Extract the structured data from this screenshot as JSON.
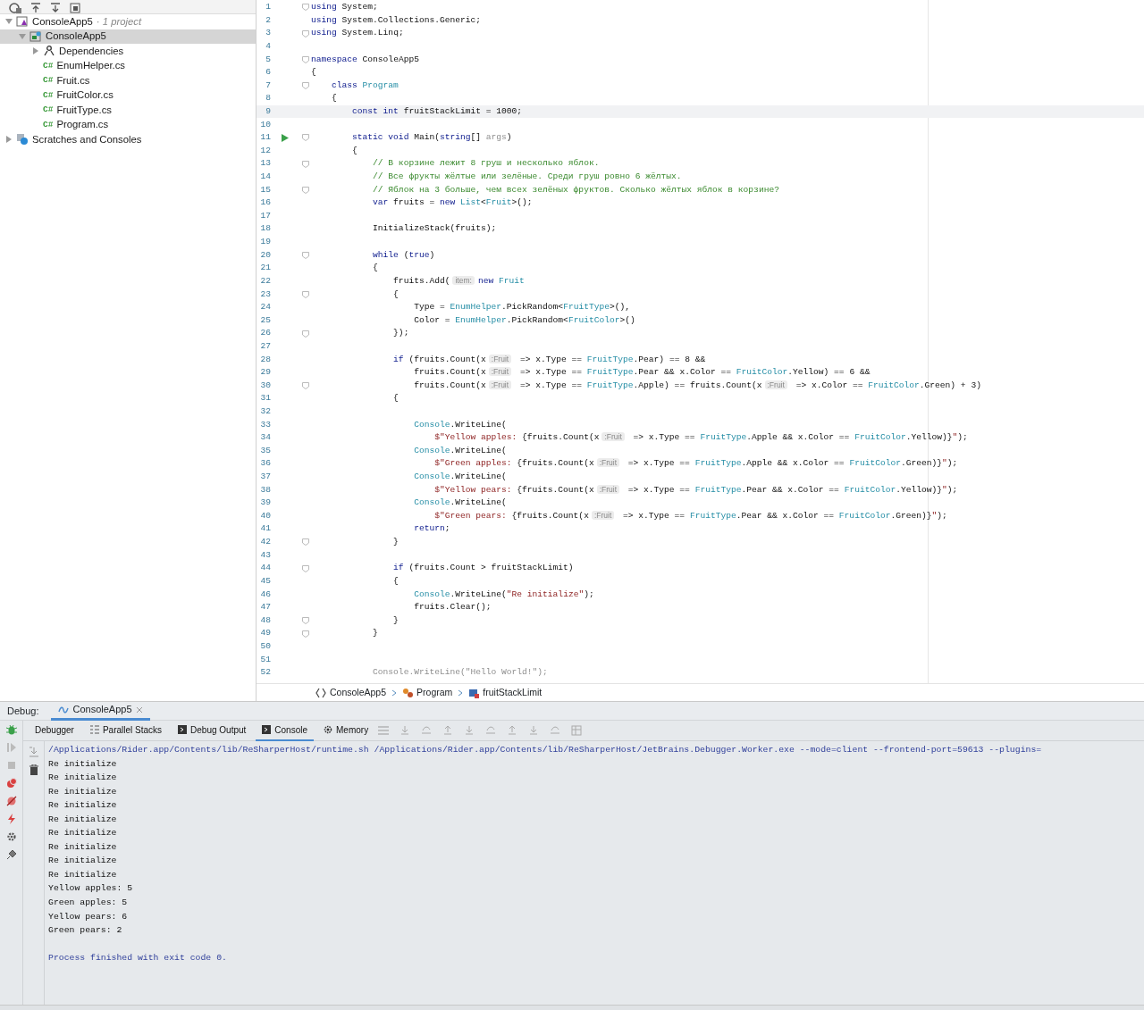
{
  "project_tree": [
    {
      "label": "ConsoleApp5",
      "note": "· 1 project",
      "kind": "solution",
      "expanded": true,
      "selected": false,
      "children": [
        {
          "label": "ConsoleApp5",
          "kind": "project",
          "expanded": true,
          "selected": true,
          "children": [
            {
              "label": "Dependencies",
              "kind": "dependencies",
              "expanded": false,
              "selected": false
            },
            {
              "label": "EnumHelper.cs",
              "badge": "C#",
              "kind": "file",
              "selected": false
            },
            {
              "label": "Fruit.cs",
              "badge": "C#",
              "kind": "file",
              "selected": false
            },
            {
              "label": "FruitColor.cs",
              "badge": "C#",
              "kind": "file",
              "selected": false
            },
            {
              "label": "FruitType.cs",
              "badge": "C#",
              "kind": "file",
              "selected": false
            },
            {
              "label": "Program.cs",
              "badge": "C#",
              "kind": "file",
              "selected": false
            }
          ]
        }
      ]
    },
    {
      "label": "Scratches and Consoles",
      "kind": "scratches",
      "expanded": false,
      "selected": false
    }
  ],
  "editor": {
    "lines": [
      {
        "number": "1",
        "fold": true,
        "tokens": [
          {
            "kind": "kw",
            "text": "using"
          },
          {
            "kind": "plain",
            "text": " System;"
          }
        ]
      },
      {
        "number": "2",
        "tokens": [
          {
            "kind": "kw",
            "text": "using"
          },
          {
            "kind": "plain",
            "text": " System.Collections.Generic;"
          }
        ]
      },
      {
        "number": "3",
        "fold": true,
        "tokens": [
          {
            "kind": "kw",
            "text": "using"
          },
          {
            "kind": "plain",
            "text": " System.Linq;"
          }
        ]
      },
      {
        "number": "4"
      },
      {
        "number": "5",
        "fold": true,
        "tokens": [
          {
            "kind": "kw",
            "text": "namespace"
          },
          {
            "kind": "plain",
            "text": " ConsoleApp5"
          }
        ]
      },
      {
        "number": "6",
        "tokens": [
          {
            "kind": "plain",
            "text": "{"
          }
        ]
      },
      {
        "number": "7",
        "fold": true,
        "tokens": [
          {
            "kind": "kw",
            "text": "    class "
          },
          {
            "kind": "type",
            "text": "Program"
          }
        ]
      },
      {
        "number": "8",
        "tokens": [
          {
            "kind": "plain",
            "text": "    {"
          }
        ]
      },
      {
        "number": "9",
        "highlighted": true,
        "tokens": [
          {
            "kind": "kw",
            "text": "        const int"
          },
          {
            "kind": "plain",
            "text": " fruitStackLimit = 1000;"
          }
        ]
      },
      {
        "number": "10"
      },
      {
        "number": "11",
        "run": true,
        "fold": true,
        "tokens": [
          {
            "kind": "kw",
            "text": "        static void"
          },
          {
            "kind": "plain",
            "text": " Main("
          },
          {
            "kind": "kw",
            "text": "string"
          },
          {
            "kind": "plain",
            "text": "[] "
          },
          {
            "kind": "dim",
            "text": "args"
          },
          {
            "kind": "plain",
            "text": ")"
          }
        ]
      },
      {
        "number": "12",
        "tokens": [
          {
            "kind": "plain",
            "text": "        {"
          }
        ]
      },
      {
        "number": "13",
        "fold": true,
        "tokens": [
          {
            "kind": "comment",
            "text": "            // В корзине лежит 8 груш и несколько яблок."
          }
        ]
      },
      {
        "number": "14",
        "tokens": [
          {
            "kind": "comment",
            "text": "            // Все фрукты жёлтые или зелёные. Среди груш ровно 6 жёлтых."
          }
        ]
      },
      {
        "number": "15",
        "fold": true,
        "tokens": [
          {
            "kind": "comment",
            "text": "            // Яблок на 3 больше, чем всех зелёных фруктов. Сколько жёлтых яблок в корзине?"
          }
        ]
      },
      {
        "number": "16",
        "tokens": [
          {
            "kind": "kw",
            "text": "            var"
          },
          {
            "kind": "plain",
            "text": " fruits = "
          },
          {
            "kind": "kw",
            "text": "new "
          },
          {
            "kind": "type",
            "text": "List"
          },
          {
            "kind": "plain",
            "text": "<"
          },
          {
            "kind": "type",
            "text": "Fruit"
          },
          {
            "kind": "plain",
            "text": ">();"
          }
        ]
      },
      {
        "number": "17"
      },
      {
        "number": "18",
        "tokens": [
          {
            "kind": "plain",
            "text": "            InitializeStack(fruits);"
          }
        ]
      },
      {
        "number": "19"
      },
      {
        "number": "20",
        "fold": true,
        "tokens": [
          {
            "kind": "kw",
            "text": "            while"
          },
          {
            "kind": "plain",
            "text": " ("
          },
          {
            "kind": "kw",
            "text": "true"
          },
          {
            "kind": "plain",
            "text": ")"
          }
        ]
      },
      {
        "number": "21",
        "tokens": [
          {
            "kind": "plain",
            "text": "            {"
          }
        ]
      },
      {
        "number": "22",
        "tokens": [
          {
            "kind": "plain",
            "text": "                fruits.Add("
          },
          {
            "kind": "hint",
            "text": "item:"
          },
          {
            "kind": "kw",
            "text": "new "
          },
          {
            "kind": "type",
            "text": "Fruit"
          }
        ]
      },
      {
        "number": "23",
        "fold": true,
        "tokens": [
          {
            "kind": "plain",
            "text": "                {"
          }
        ]
      },
      {
        "number": "24",
        "tokens": [
          {
            "kind": "plain",
            "text": "                    Type = "
          },
          {
            "kind": "type",
            "text": "EnumHelper"
          },
          {
            "kind": "plain",
            "text": ".PickRandom<"
          },
          {
            "kind": "type",
            "text": "FruitType"
          },
          {
            "kind": "plain",
            "text": ">(),"
          }
        ]
      },
      {
        "number": "25",
        "tokens": [
          {
            "kind": "plain",
            "text": "                    Color = "
          },
          {
            "kind": "type",
            "text": "EnumHelper"
          },
          {
            "kind": "plain",
            "text": ".PickRandom<"
          },
          {
            "kind": "type",
            "text": "FruitColor"
          },
          {
            "kind": "plain",
            "text": ">()"
          }
        ]
      },
      {
        "number": "26",
        "fold": true,
        "tokens": [
          {
            "kind": "plain",
            "text": "                });"
          }
        ]
      },
      {
        "number": "27"
      },
      {
        "number": "28",
        "tokens": [
          {
            "kind": "kw",
            "text": "                if"
          },
          {
            "kind": "plain",
            "text": " (fruits.Count(x"
          },
          {
            "kind": "hint",
            "text": ":Fruit"
          },
          {
            "kind": "plain",
            "text": " => x.Type == "
          },
          {
            "kind": "type",
            "text": "FruitType"
          },
          {
            "kind": "plain",
            "text": ".Pear) == 8 &&"
          }
        ]
      },
      {
        "number": "29",
        "tokens": [
          {
            "kind": "plain",
            "text": "                    fruits.Count(x"
          },
          {
            "kind": "hint",
            "text": ":Fruit"
          },
          {
            "kind": "plain",
            "text": " => x.Type == "
          },
          {
            "kind": "type",
            "text": "FruitType"
          },
          {
            "kind": "plain",
            "text": ".Pear && x.Color == "
          },
          {
            "kind": "type",
            "text": "FruitColor"
          },
          {
            "kind": "plain",
            "text": ".Yellow) == 6 &&"
          }
        ]
      },
      {
        "number": "30",
        "fold": true,
        "tokens": [
          {
            "kind": "plain",
            "text": "                    fruits.Count(x"
          },
          {
            "kind": "hint",
            "text": ":Fruit"
          },
          {
            "kind": "plain",
            "text": " => x.Type == "
          },
          {
            "kind": "type",
            "text": "FruitType"
          },
          {
            "kind": "plain",
            "text": ".Apple) == fruits.Count(x"
          },
          {
            "kind": "hint",
            "text": ":Fruit"
          },
          {
            "kind": "plain",
            "text": " => x.Color == "
          },
          {
            "kind": "type",
            "text": "FruitColor"
          },
          {
            "kind": "plain",
            "text": ".Green) + 3)"
          }
        ]
      },
      {
        "number": "31",
        "tokens": [
          {
            "kind": "plain",
            "text": "                {"
          }
        ]
      },
      {
        "number": "32"
      },
      {
        "number": "33",
        "tokens": [
          {
            "kind": "type",
            "text": "                    Console"
          },
          {
            "kind": "plain",
            "text": ".WriteLine("
          }
        ]
      },
      {
        "number": "34",
        "tokens": [
          {
            "kind": "str",
            "text": "                        $\"Yellow apples: "
          },
          {
            "kind": "plain",
            "text": "{fruits.Count(x"
          },
          {
            "kind": "hint",
            "text": ":Fruit"
          },
          {
            "kind": "plain",
            "text": " => x.Type == "
          },
          {
            "kind": "type",
            "text": "FruitType"
          },
          {
            "kind": "plain",
            "text": ".Apple && x.Color == "
          },
          {
            "kind": "type",
            "text": "FruitColor"
          },
          {
            "kind": "plain",
            "text": ".Yellow)}"
          },
          {
            "kind": "str",
            "text": "\""
          },
          {
            "kind": "plain",
            "text": ");"
          }
        ]
      },
      {
        "number": "35",
        "tokens": [
          {
            "kind": "type",
            "text": "                    Console"
          },
          {
            "kind": "plain",
            "text": ".WriteLine("
          }
        ]
      },
      {
        "number": "36",
        "tokens": [
          {
            "kind": "str",
            "text": "                        $\"Green apples: "
          },
          {
            "kind": "plain",
            "text": "{fruits.Count(x"
          },
          {
            "kind": "hint",
            "text": ":Fruit"
          },
          {
            "kind": "plain",
            "text": " => x.Type == "
          },
          {
            "kind": "type",
            "text": "FruitType"
          },
          {
            "kind": "plain",
            "text": ".Apple && x.Color == "
          },
          {
            "kind": "type",
            "text": "FruitColor"
          },
          {
            "kind": "plain",
            "text": ".Green)}"
          },
          {
            "kind": "str",
            "text": "\""
          },
          {
            "kind": "plain",
            "text": ");"
          }
        ]
      },
      {
        "number": "37",
        "tokens": [
          {
            "kind": "type",
            "text": "                    Console"
          },
          {
            "kind": "plain",
            "text": ".WriteLine("
          }
        ]
      },
      {
        "number": "38",
        "tokens": [
          {
            "kind": "str",
            "text": "                        $\"Yellow pears: "
          },
          {
            "kind": "plain",
            "text": "{fruits.Count(x"
          },
          {
            "kind": "hint",
            "text": ":Fruit"
          },
          {
            "kind": "plain",
            "text": " => x.Type == "
          },
          {
            "kind": "type",
            "text": "FruitType"
          },
          {
            "kind": "plain",
            "text": ".Pear && x.Color == "
          },
          {
            "kind": "type",
            "text": "FruitColor"
          },
          {
            "kind": "plain",
            "text": ".Yellow)}"
          },
          {
            "kind": "str",
            "text": "\""
          },
          {
            "kind": "plain",
            "text": ");"
          }
        ]
      },
      {
        "number": "39",
        "tokens": [
          {
            "kind": "type",
            "text": "                    Console"
          },
          {
            "kind": "plain",
            "text": ".WriteLine("
          }
        ]
      },
      {
        "number": "40",
        "tokens": [
          {
            "kind": "str",
            "text": "                        $\"Green pears: "
          },
          {
            "kind": "plain",
            "text": "{fruits.Count(x"
          },
          {
            "kind": "hint",
            "text": ":Fruit"
          },
          {
            "kind": "plain",
            "text": " => x.Type == "
          },
          {
            "kind": "type",
            "text": "FruitType"
          },
          {
            "kind": "plain",
            "text": ".Pear && x.Color == "
          },
          {
            "kind": "type",
            "text": "FruitColor"
          },
          {
            "kind": "plain",
            "text": ".Green)}"
          },
          {
            "kind": "str",
            "text": "\""
          },
          {
            "kind": "plain",
            "text": ");"
          }
        ]
      },
      {
        "number": "41",
        "tokens": [
          {
            "kind": "kw",
            "text": "                    return"
          },
          {
            "kind": "plain",
            "text": ";"
          }
        ]
      },
      {
        "number": "42",
        "fold": true,
        "tokens": [
          {
            "kind": "plain",
            "text": "                }"
          }
        ]
      },
      {
        "number": "43"
      },
      {
        "number": "44",
        "fold": true,
        "tokens": [
          {
            "kind": "kw",
            "text": "                if"
          },
          {
            "kind": "plain",
            "text": " (fruits.Count > fruitStackLimit)"
          }
        ]
      },
      {
        "number": "45",
        "tokens": [
          {
            "kind": "plain",
            "text": "                {"
          }
        ]
      },
      {
        "number": "46",
        "tokens": [
          {
            "kind": "type",
            "text": "                    Console"
          },
          {
            "kind": "plain",
            "text": ".WriteLine("
          },
          {
            "kind": "str",
            "text": "\"Re initialize\""
          },
          {
            "kind": "plain",
            "text": ");"
          }
        ]
      },
      {
        "number": "47",
        "tokens": [
          {
            "kind": "plain",
            "text": "                    fruits.Clear();"
          }
        ]
      },
      {
        "number": "48",
        "fold": true,
        "tokens": [
          {
            "kind": "plain",
            "text": "                }"
          }
        ]
      },
      {
        "number": "49",
        "fold": true,
        "tokens": [
          {
            "kind": "plain",
            "text": "            }"
          }
        ]
      },
      {
        "number": "50"
      },
      {
        "number": "51"
      },
      {
        "number": "52",
        "tokens": [
          {
            "kind": "dim",
            "text": "            Console.WriteLine(\"Hello World!\");"
          }
        ]
      }
    ]
  },
  "breadcrumbs": [
    {
      "label": "ConsoleApp5",
      "kind": "namespace"
    },
    {
      "label": "Program",
      "kind": "class"
    },
    {
      "label": "fruitStackLimit",
      "kind": "field"
    }
  ],
  "debug": {
    "title": "Debug:",
    "session": {
      "label": "ConsoleApp5"
    },
    "tabs": [
      {
        "label": "Debugger",
        "kind": "plain",
        "selected": false
      },
      {
        "label": "Parallel Stacks",
        "kind": "stacks",
        "selected": false
      },
      {
        "label": "Debug Output",
        "kind": "terminal",
        "selected": false
      },
      {
        "label": "Console",
        "kind": "terminal",
        "selected": true
      },
      {
        "label": "Memory",
        "kind": "chip",
        "selected": false
      }
    ],
    "console": [
      {
        "kind": "system",
        "text": "/Applications/Rider.app/Contents/lib/ReSharperHost/runtime.sh /Applications/Rider.app/Contents/lib/ReSharperHost/JetBrains.Debugger.Worker.exe --mode=client --frontend-port=59613 --plugins="
      },
      {
        "kind": "output",
        "text": "Re initialize"
      },
      {
        "kind": "output",
        "text": "Re initialize"
      },
      {
        "kind": "output",
        "text": "Re initialize"
      },
      {
        "kind": "output",
        "text": "Re initialize"
      },
      {
        "kind": "output",
        "text": "Re initialize"
      },
      {
        "kind": "output",
        "text": "Re initialize"
      },
      {
        "kind": "output",
        "text": "Re initialize"
      },
      {
        "kind": "output",
        "text": "Re initialize"
      },
      {
        "kind": "output",
        "text": "Re initialize"
      },
      {
        "kind": "output",
        "text": "Yellow apples: 5"
      },
      {
        "kind": "output",
        "text": "Green apples: 5"
      },
      {
        "kind": "output",
        "text": "Yellow pears: 6"
      },
      {
        "kind": "output",
        "text": "Green pears: 2"
      },
      {
        "kind": "system",
        "gap_before": true,
        "text": "Process finished with exit code 0."
      }
    ]
  }
}
